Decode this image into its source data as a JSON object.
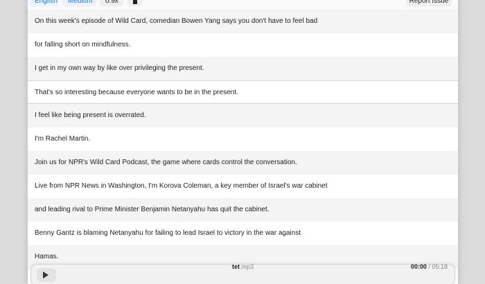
{
  "toolbar": {
    "language": "English",
    "level": "Medium",
    "speed": "0.9x",
    "report_label": "Report Issue"
  },
  "transcript": [
    "On this week's episode of Wild Card, comedian Bowen Yang says you don't have to feel bad",
    "for falling short on mindfulness.",
    "I get in my own way by like over privileging the present.",
    "That's so interesting because everyone wants to be in the present.",
    "I feel like being present is overrated.",
    "I'm Rachel Martin.",
    "Join us for NPR's Wild Card Podcast, the game where cards control the conversation.",
    "Live from NPR News in Washington, I'm Korova Coleman, a key member of Israel's war cabinet",
    "and leading rival to Prime Minister Benjamin Netanyahu has quit the cabinet.",
    "Benny Gantz is blaming Netanyahu for failing to lead Israel to victory in the war against",
    "Hamas."
  ],
  "active_index": 3,
  "player": {
    "file_name": "tet",
    "file_ext": ".mp3",
    "current_time": "00:00",
    "separator": " / ",
    "duration": "05:18"
  }
}
